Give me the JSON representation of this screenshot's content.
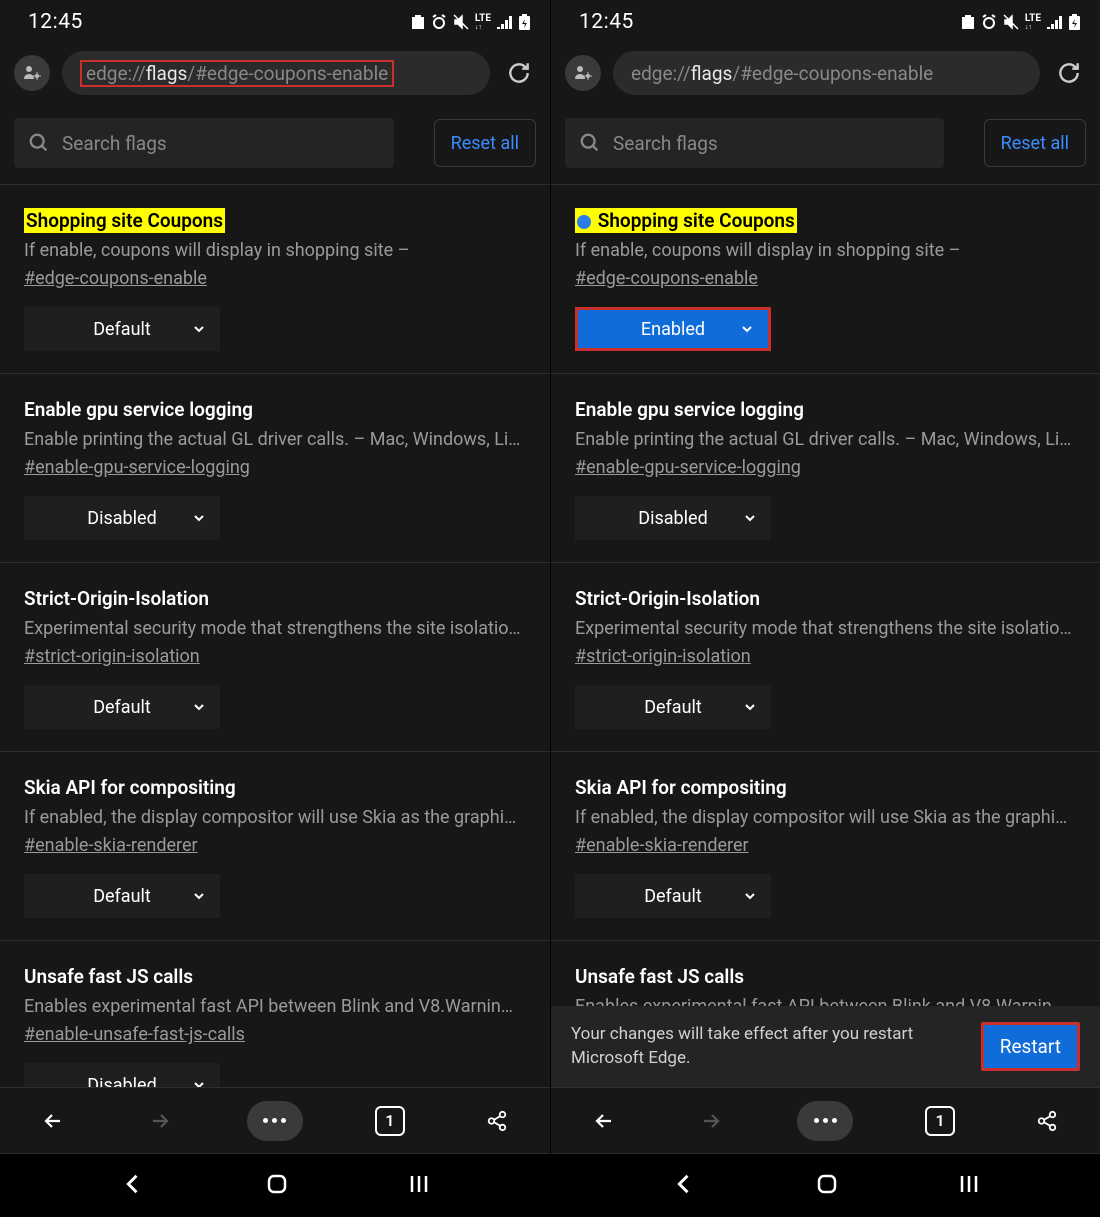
{
  "status": {
    "time": "12:45"
  },
  "url": {
    "protocol": "edge://",
    "host": "flags",
    "path": "/#edge-coupons-enable"
  },
  "search": {
    "placeholder": "Search flags"
  },
  "reset_label": "Reset all",
  "flags": [
    {
      "title": "Shopping site Coupons",
      "desc": "If enable, coupons will display in shopping site –",
      "hash": "#edge-coupons-enable",
      "left_value": "Default",
      "right_value": "Enabled",
      "highlighted": true
    },
    {
      "title": "Enable gpu service logging",
      "desc": "Enable printing the actual GL driver calls. – Mac, Windows, Li…",
      "hash": "#enable-gpu-service-logging",
      "left_value": "Disabled",
      "right_value": "Disabled"
    },
    {
      "title": "Strict-Origin-Isolation",
      "desc": "Experimental security mode that strengthens the site isolatio…",
      "hash": "#strict-origin-isolation",
      "left_value": "Default",
      "right_value": "Default"
    },
    {
      "title": "Skia API for compositing",
      "desc": "If enabled, the display compositor will use Skia as the graphi…",
      "hash": "#enable-skia-renderer",
      "left_value": "Default",
      "right_value": "Default"
    },
    {
      "title": "Unsafe fast JS calls",
      "desc": "Enables experimental fast API between Blink and V8.Warnin…",
      "hash": "#enable-unsafe-fast-js-calls",
      "left_value": "Disabled",
      "right_value": ""
    }
  ],
  "restart": {
    "text": "Your changes will take effect after you restart Microsoft Edge.",
    "button": "Restart"
  },
  "tab_count": "1"
}
